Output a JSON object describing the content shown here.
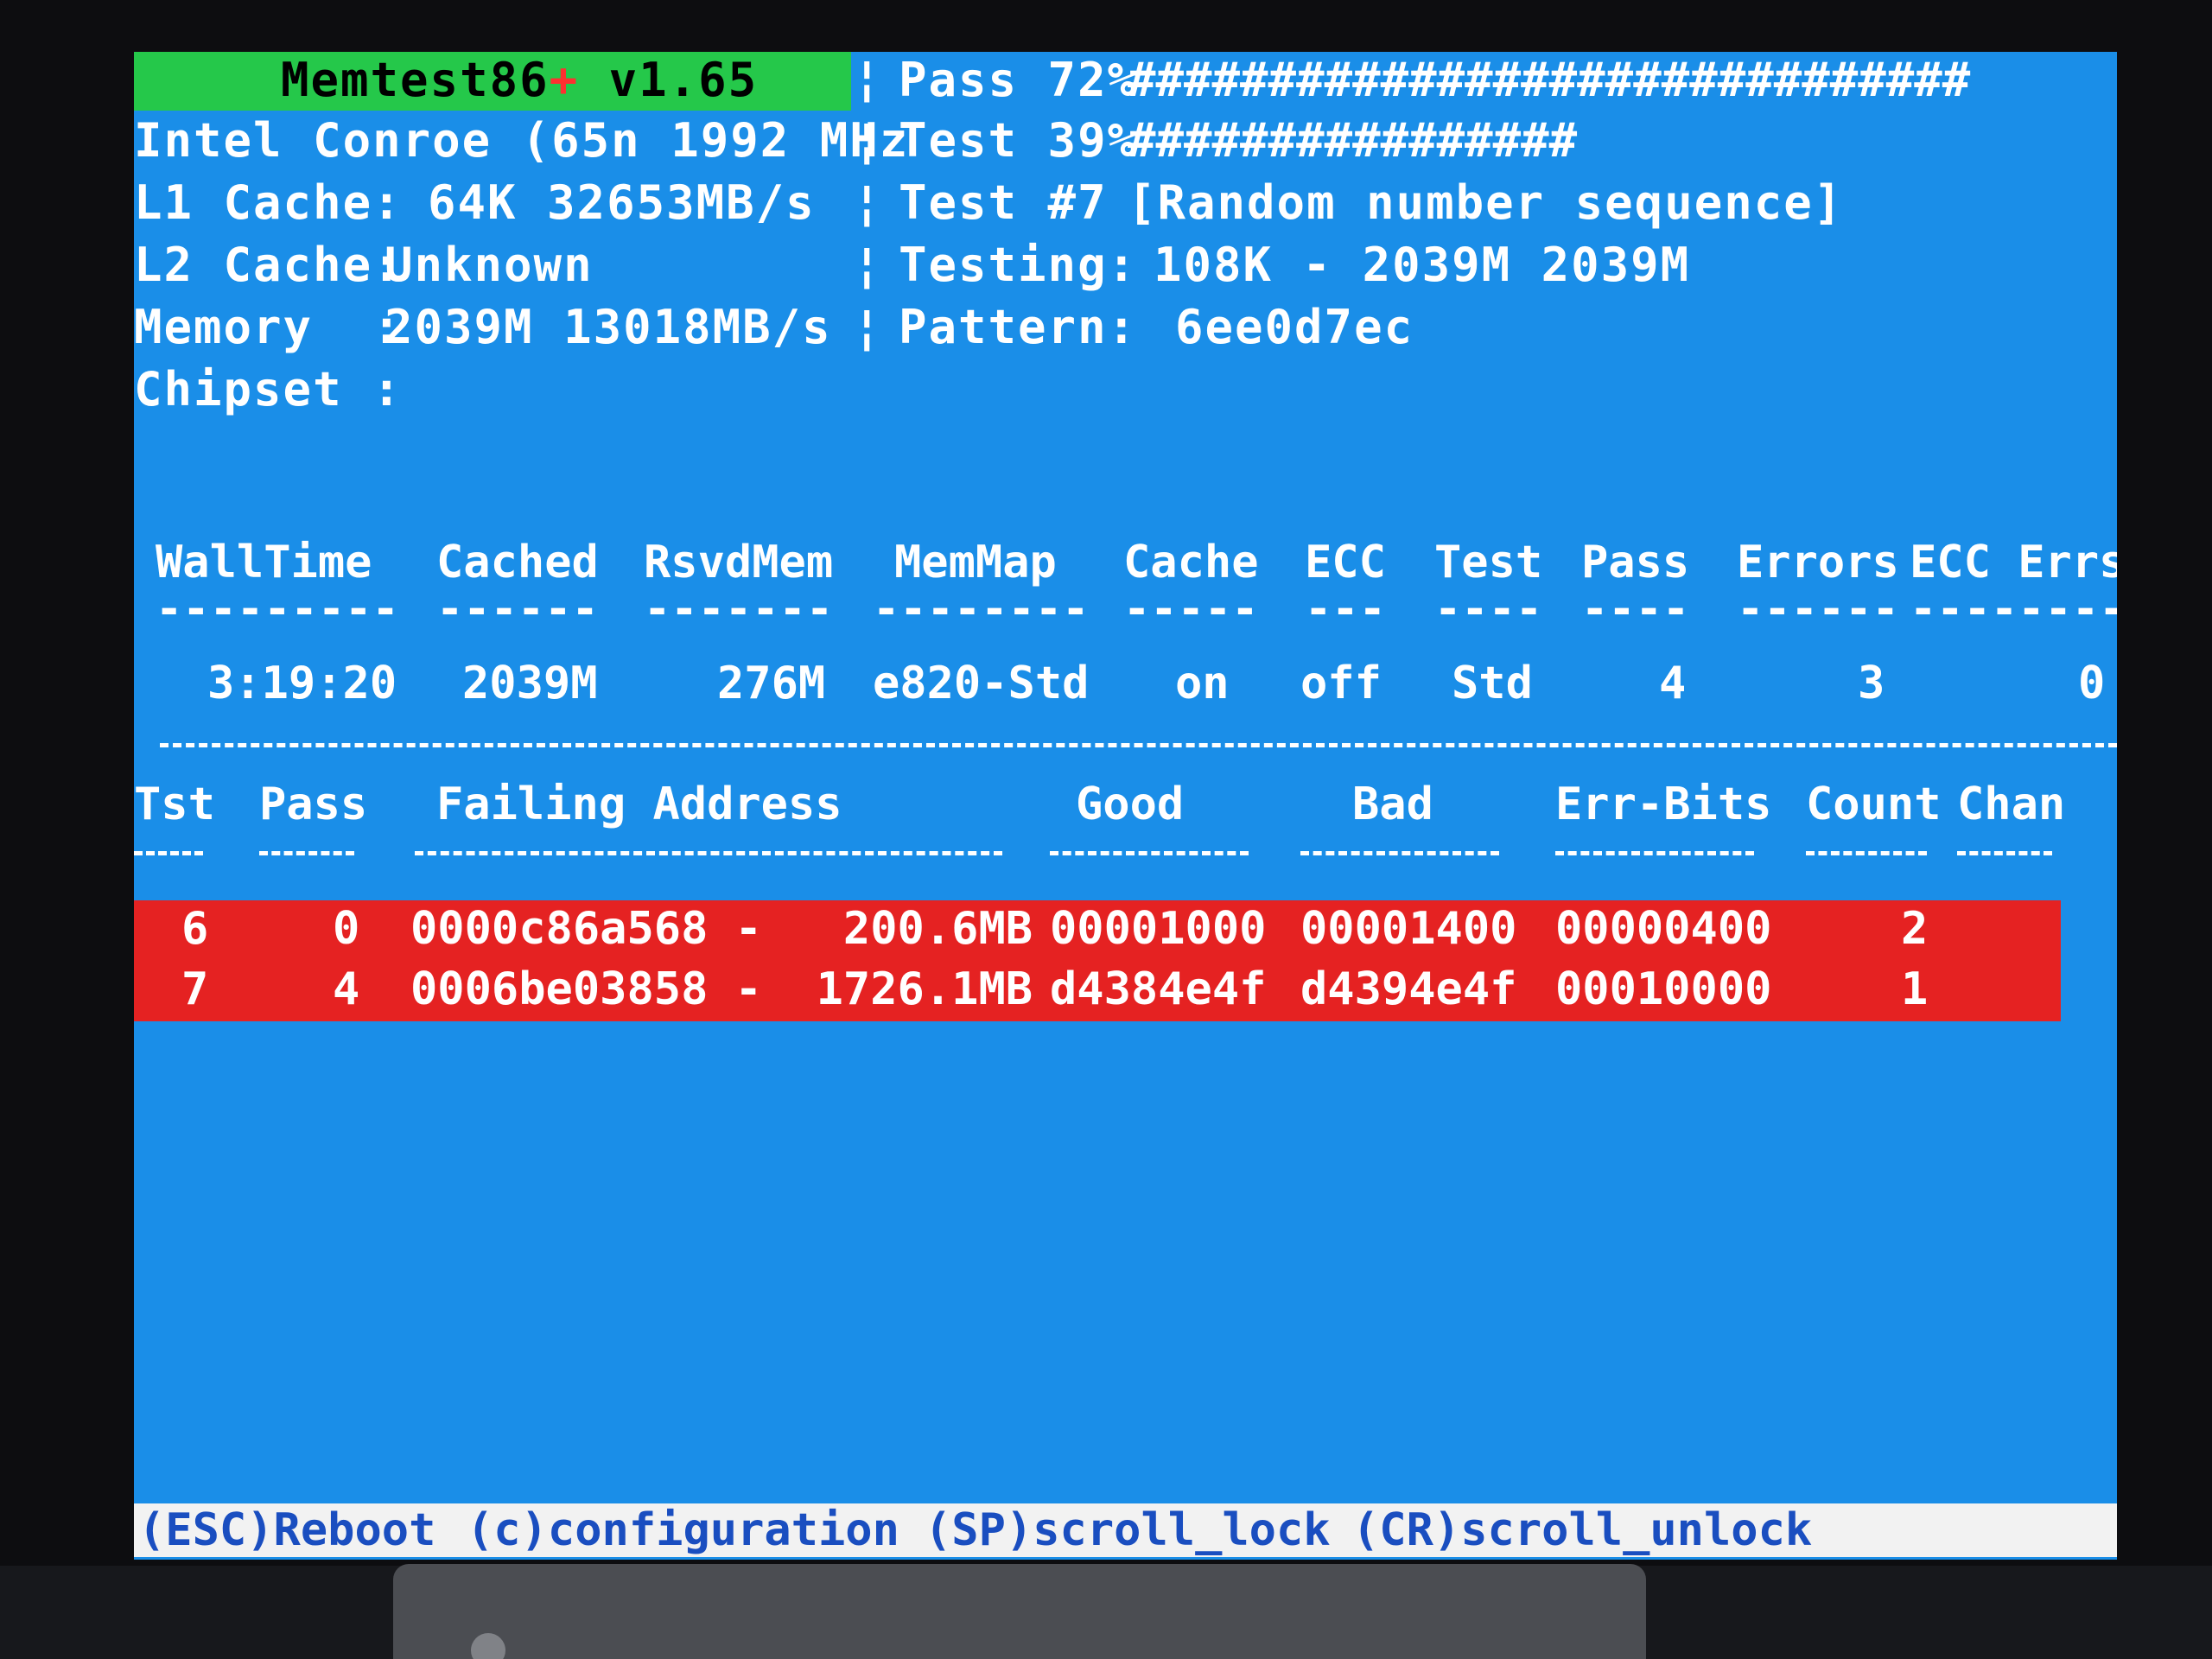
{
  "header": {
    "title": "Memtest86",
    "title_plus": "+",
    "version": " v1.65",
    "cpu": "Intel Conroe (65n 1992 MHz",
    "l1_label": "L1 Cache:",
    "l1_value": "64K 32653MB/s",
    "l2_label": "L2 Cache:",
    "l2_value": "Unknown",
    "mem_label": "Memory  :",
    "mem_value": "2039M 13018MB/s",
    "chipset_label": "Chipset :",
    "pass_label": "Pass 72%",
    "pass_bar": "##############################",
    "test_label": "Test 39%",
    "test_bar": "################",
    "testnum_label": "Test #7",
    "testnum_value": "[Random number sequence]",
    "testing_label": "Testing:",
    "testing_value": "108K - 2039M 2039M",
    "pattern_label": "Pattern:",
    "pattern_value": "6ee0d7ec"
  },
  "stats": {
    "headers": [
      "WallTime",
      "Cached",
      "RsvdMem",
      "MemMap",
      "Cache",
      "ECC",
      "Test",
      "Pass",
      "Errors",
      "ECC Errs"
    ],
    "dashes": [
      "---------",
      "------",
      "-------",
      "--------",
      "-----",
      "---",
      "----",
      "----",
      "------",
      "--------"
    ],
    "values": [
      "3:19:20",
      "2039M",
      "276M",
      "e820-Std",
      "on",
      "off",
      "Std",
      "4",
      "3",
      "0"
    ]
  },
  "errors": {
    "headers": [
      "Tst",
      "Pass",
      "Failing Address",
      "Good",
      "Bad",
      "Err-Bits",
      "Count",
      "Chan"
    ],
    "rows": [
      [
        "6",
        "0",
        "0000c86a568 -   200.6MB",
        "00001000",
        "00001400",
        "00000400",
        "2",
        ""
      ],
      [
        "7",
        "4",
        "0006be03858 -  1726.1MB",
        "d4384e4f",
        "d4394e4f",
        "00010000",
        "1",
        ""
      ]
    ]
  },
  "footer": {
    "reboot": "(ESC)Reboot",
    "config": "(c)configuration",
    "scroll_lock": "(SP)scroll_lock",
    "scroll_unlock": "(CR)scroll_unlock"
  }
}
